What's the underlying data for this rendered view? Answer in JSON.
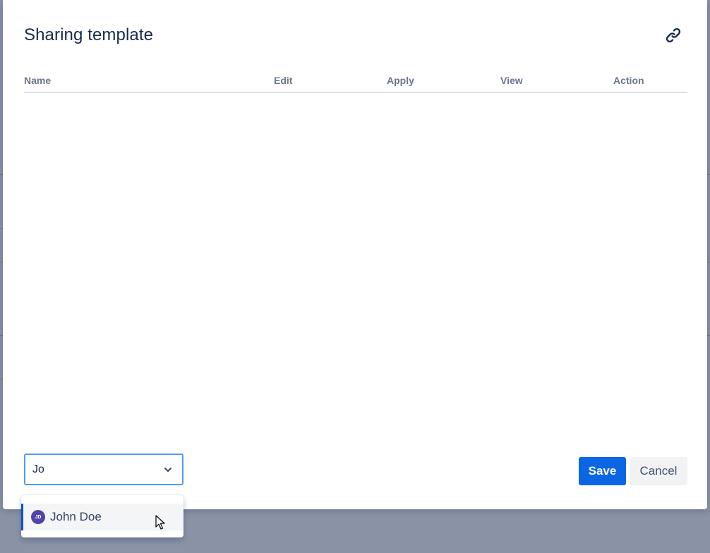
{
  "modal": {
    "title": "Sharing template"
  },
  "table": {
    "columns": [
      "Name",
      "Edit",
      "Apply",
      "View",
      "Action"
    ]
  },
  "user_select": {
    "value": "Jo"
  },
  "dropdown": {
    "options": [
      {
        "initials": "JD",
        "label": "John Doe"
      }
    ]
  },
  "footer": {
    "save_label": "Save",
    "cancel_label": "Cancel"
  },
  "colors": {
    "primary": "#0c66e4",
    "avatar": "#5243aa",
    "focus_border": "#4c9aff",
    "overlay": "#8a93a6"
  },
  "icons": {
    "link": "link-icon",
    "chevron": "chevron-down-icon",
    "cursor": "mouse-cursor-icon"
  }
}
